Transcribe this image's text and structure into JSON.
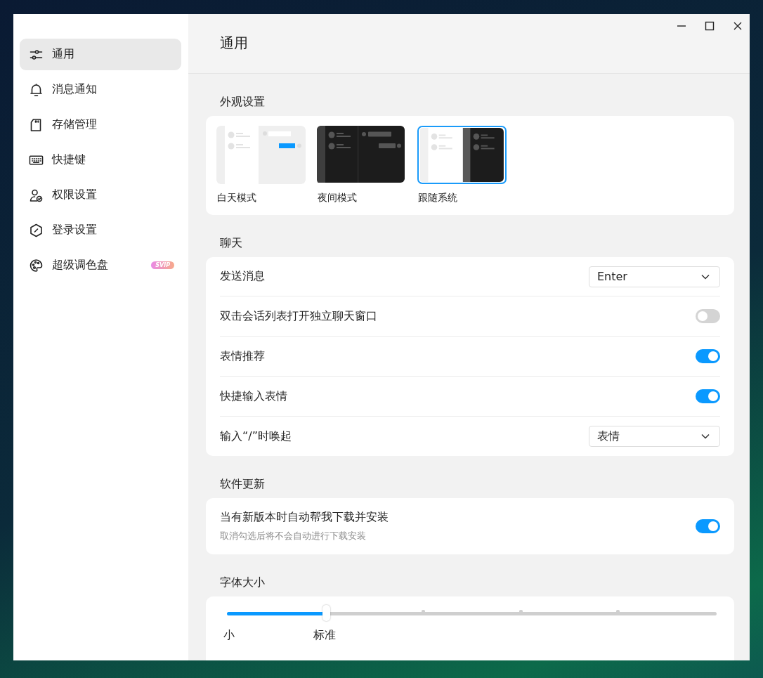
{
  "sidebar": {
    "items": [
      {
        "label": "通用",
        "selected": true
      },
      {
        "label": "消息通知",
        "selected": false
      },
      {
        "label": "存储管理",
        "selected": false
      },
      {
        "label": "快捷键",
        "selected": false
      },
      {
        "label": "权限设置",
        "selected": false
      },
      {
        "label": "登录设置",
        "selected": false
      },
      {
        "label": "超级调色盘",
        "selected": false,
        "badge": "SVIP"
      }
    ]
  },
  "page": {
    "title": "通用"
  },
  "sections": [
    {
      "title": "外观设置",
      "kind": "themes",
      "themes": [
        {
          "label": "白天模式",
          "kind": "light",
          "selected": false
        },
        {
          "label": "夜间模式",
          "kind": "dark",
          "selected": false
        },
        {
          "label": "跟随系统",
          "kind": "system",
          "selected": true
        }
      ]
    },
    {
      "title": "聊天",
      "kind": "rows",
      "rows": [
        {
          "kind": "select",
          "label": "发送消息",
          "value": "Enter"
        },
        {
          "kind": "toggle",
          "label": "双击会话列表打开独立聊天窗口",
          "on": false
        },
        {
          "kind": "toggle",
          "label": "表情推荐",
          "on": true
        },
        {
          "kind": "toggle",
          "label": "快捷输入表情",
          "on": true
        },
        {
          "kind": "select",
          "label": "输入“/”时唤起",
          "value": "表情"
        }
      ]
    },
    {
      "title": "软件更新",
      "kind": "rows",
      "rows": [
        {
          "kind": "toggle",
          "label": "当有新版本时自动帮我下载并安装",
          "description": "取消勾选后将不会自动进行下载安装",
          "on": true
        }
      ]
    },
    {
      "title": "字体大小",
      "kind": "slider",
      "level": 0.2,
      "stops": [
        {
          "kind": "labeled",
          "label": "小"
        },
        {
          "kind": "labeled",
          "label": "标准"
        },
        {
          "kind": "plain"
        },
        {
          "kind": "plain"
        },
        {
          "kind": "plain"
        },
        {
          "kind": "plain"
        }
      ]
    }
  ]
}
